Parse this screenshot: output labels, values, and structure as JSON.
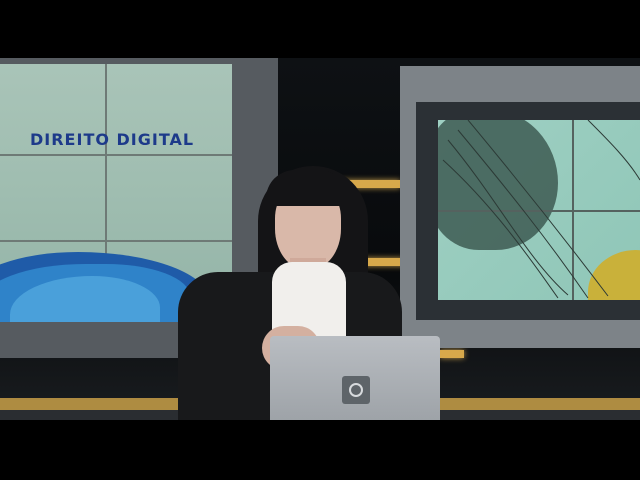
{
  "screen_title": "DIREITO DIGITAL",
  "colors": {
    "title_text": "#1d3a8a",
    "accent_light": "#d8a94b"
  },
  "icons": {
    "laptop_logo": "channel-logo-icon"
  }
}
